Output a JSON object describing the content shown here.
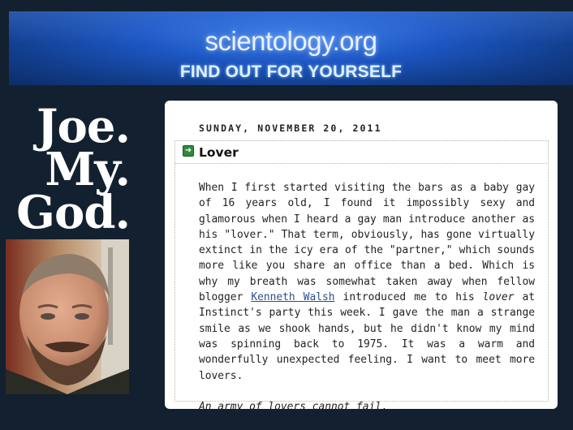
{
  "banner": {
    "site": "scientology.org",
    "tagline": "FIND OUT FOR YOURSELF"
  },
  "sidebar": {
    "title_lines": [
      "Joe.",
      "My.",
      "God."
    ]
  },
  "post": {
    "date": "SUNDAY, NOVEMBER 20, 2011",
    "title": "Lover",
    "p1_a": "When I first started visiting the bars as a baby gay of 16 years old, I found it impossibly sexy and glamorous when I heard a gay man introduce another as his \"lover.\" That term, obviously, has gone virtually extinct in the icy era of the \"partner,\" which sounds more like you share an office than a bed. Which is why my breath was somewhat taken away when fellow blogger ",
    "p1_link": "Kenneth Walsh",
    "p1_b": " introduced me to his ",
    "p1_em": "lover",
    "p1_c": " at Instinct's party this week. I gave the man a strange smile as we shook hands, but he didn't know my mind was spinning back to 1975. It was a warm and wonderfully unexpected feeling. I want to meet more lovers.",
    "p2": "An army of lovers cannot fail."
  },
  "colors": {
    "page_background": "#13202f",
    "link": "#2b4f8e",
    "icon_green": "#2d8a3a"
  }
}
